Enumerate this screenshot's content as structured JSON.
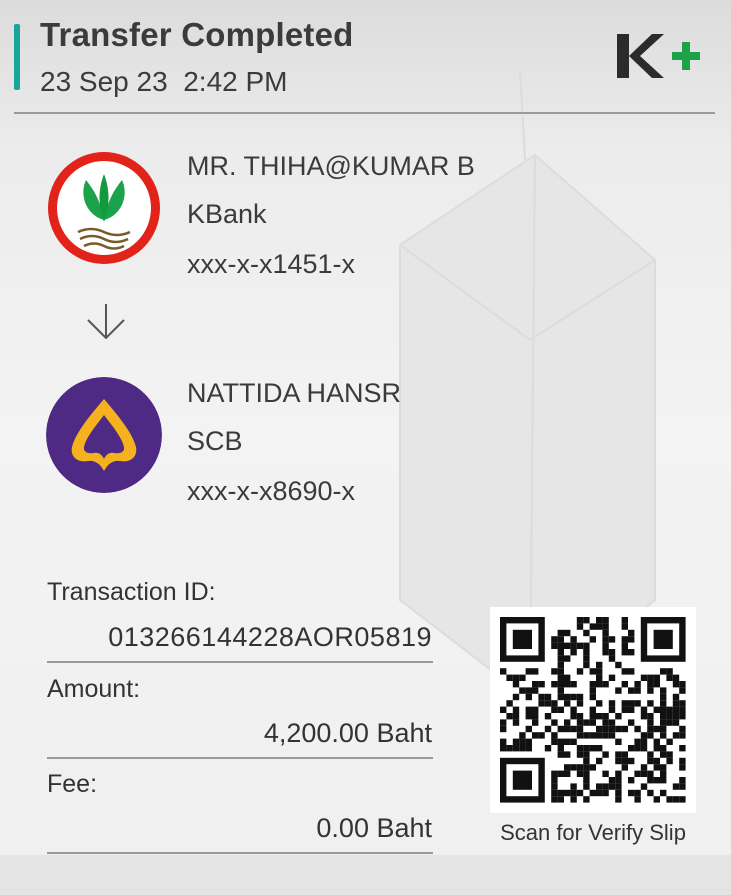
{
  "header": {
    "title": "Transfer Completed",
    "datetime": "23 Sep 23  2:42 PM",
    "logo_text": "K+"
  },
  "sender": {
    "name": "MR. THIHA@KUMAR B",
    "bank": "KBank",
    "account": "xxx-x-x1451-x",
    "icon": "kbank-logo"
  },
  "arrow_icon": "down-arrow-icon",
  "receiver": {
    "name": "NATTIDA HANSR",
    "bank": "SCB",
    "account": "xxx-x-x8690-x",
    "icon": "scb-logo"
  },
  "details": {
    "transaction_label": "Transaction ID:",
    "transaction_id": "013266144228AOR05819",
    "amount_label": "Amount:",
    "amount_value": "4,200.00 Baht",
    "fee_label": "Fee:",
    "fee_value": "0.00 Baht"
  },
  "qr": {
    "caption": "Scan for Verify Slip"
  },
  "colors": {
    "accent": "#1aa59a",
    "kbank_green": "#1ba24b",
    "kbank_red": "#e2231a",
    "scb_purple": "#4e2a84",
    "scb_gold": "#f5b21e",
    "logo_dark": "#2b2b2b"
  }
}
